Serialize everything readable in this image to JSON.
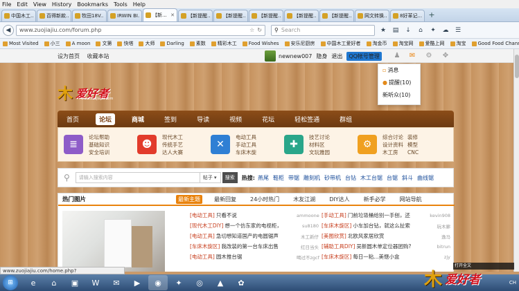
{
  "menu": [
    "File",
    "Edit",
    "View",
    "History",
    "Bookmarks",
    "Tools",
    "Help"
  ],
  "tabs": [
    {
      "label": "中国木工..."
    },
    {
      "label": "百得新款..."
    },
    {
      "label": "牧田18V..."
    },
    {
      "label": "IRWIN BI..."
    },
    {
      "label": "【新..."
    },
    {
      "label": "【新提醒..."
    },
    {
      "label": "【新提醒..."
    },
    {
      "label": "【新提醒..."
    },
    {
      "label": "【新提醒..."
    },
    {
      "label": "【新提醒..."
    },
    {
      "label": "网文转换..."
    },
    {
      "label": "8好革记..."
    }
  ],
  "nav": {
    "url": "www.zuojiajiu.com/forum.php",
    "search_placeholder": "Search"
  },
  "bookmarks": [
    "Most Visited",
    "小三",
    "A moon",
    "文第",
    "快塔",
    "大师",
    "Darling",
    "素数",
    "精彩木工",
    "Food Wishes",
    "安乐尼厨房",
    "中国木工爱好者",
    "淘金币",
    "淘宝网",
    "爱酷上网",
    "淘宝",
    "Good Food Channel"
  ],
  "topstrip": {
    "set_home": "设为首页",
    "bookmark_site": "收藏本站",
    "username": "newnew007",
    "stealth": "隐身",
    "logout": "退出",
    "qq_button": "QQ帐号管理"
  },
  "dropdown": {
    "messages": "消息",
    "reminders": "提醒(10)",
    "new_listen": "新听众(10)"
  },
  "logo": {
    "mu": "木",
    "text": "爱好者",
    "sub": "www.zuojiajiu.com"
  },
  "mainnav": [
    "首页",
    "论坛",
    "商城",
    "签到",
    "导读",
    "视频",
    "花坛",
    "轻松签通",
    "群组"
  ],
  "subnav": [
    {
      "links": [
        "论坛帮助",
        "基础知识",
        "安全培训"
      ],
      "col2": []
    },
    {
      "links": [
        "现代木工",
        "传统手艺",
        "达人大赛"
      ],
      "col2": []
    },
    {
      "links": [
        "电动工具",
        "手动工具",
        "车床木旋"
      ],
      "col2": []
    },
    {
      "links": [
        "技艺讨论",
        "材料区",
        "文玩雅园"
      ],
      "col2": []
    },
    {
      "links": [
        "综合讨论",
        "设计资料",
        "木工房"
      ],
      "col2": [
        "装修",
        "模型",
        "CNC"
      ]
    }
  ],
  "site_search": {
    "placeholder": "请输入搜索内容",
    "scope": "帖子",
    "button": "搜索",
    "hot_label": "热搜:",
    "hot_words": [
      "燕尾",
      "鞋柜",
      "带锯",
      "雕刻机",
      "砂带机",
      "台钻",
      "木工台锯",
      "台锯",
      "斜斗",
      "曲线锯"
    ]
  },
  "content": {
    "hot_images": "热门图片",
    "tabs": [
      "最新主题",
      "最新回复",
      "24小时热门",
      "木友江湖",
      "DIY达人",
      "新手必学",
      "网站导航"
    ],
    "threads": [
      [
        {
          "cat": "[电动工具]",
          "title": "只看不说",
          "author": "ammoone"
        },
        {
          "cat": "[手动工具]",
          "title": "门前垃圾桶给别一手刨，还",
          "author": "kevin908"
        }
      ],
      [
        {
          "cat": "[现代木工DIY]",
          "title": "想一个仿东家的电视柜，",
          "author": "su8180"
        },
        {
          "cat": "[车床木旋区]",
          "title": "小车加台钻，就这么扯索",
          "author": "玩木廊"
        }
      ],
      [
        {
          "cat": "[电动工具]",
          "title": "急切想知道国产的电圆锯声",
          "author": "木工新仔"
        },
        {
          "cat": "[美图欣赏]",
          "title": "北欧风家居欣赏",
          "author": "逸马"
        }
      ],
      [
        {
          "cat": "[车床木旋区]",
          "title": "我改装的第一台车床出售",
          "author": "红日当头"
        },
        {
          "cat": "[辅助工具DIY]",
          "title": "吴新圆木单定位器团购?",
          "author": "bitrun"
        }
      ],
      [
        {
          "cat": "[电动工具]",
          "title": "圆木推台锯",
          "author": "喝过不zgcf"
        },
        {
          "cat": "[车床木旋区]",
          "title": "每日一粘...美惬小盒",
          "author": "zjy"
        }
      ]
    ]
  },
  "statusbar": "www.zuojiajiu.com/home.php?mod=space&do=pm",
  "taskbar": {
    "items": [
      "e",
      "⌂",
      "▣",
      "W",
      "✉",
      "▶",
      "◉",
      "✦",
      "◎",
      "▲",
      "✿"
    ],
    "tray_text": "CH"
  },
  "watermark": {
    "mu": "木",
    "text": "爱好者",
    "bar": "打开全文"
  }
}
